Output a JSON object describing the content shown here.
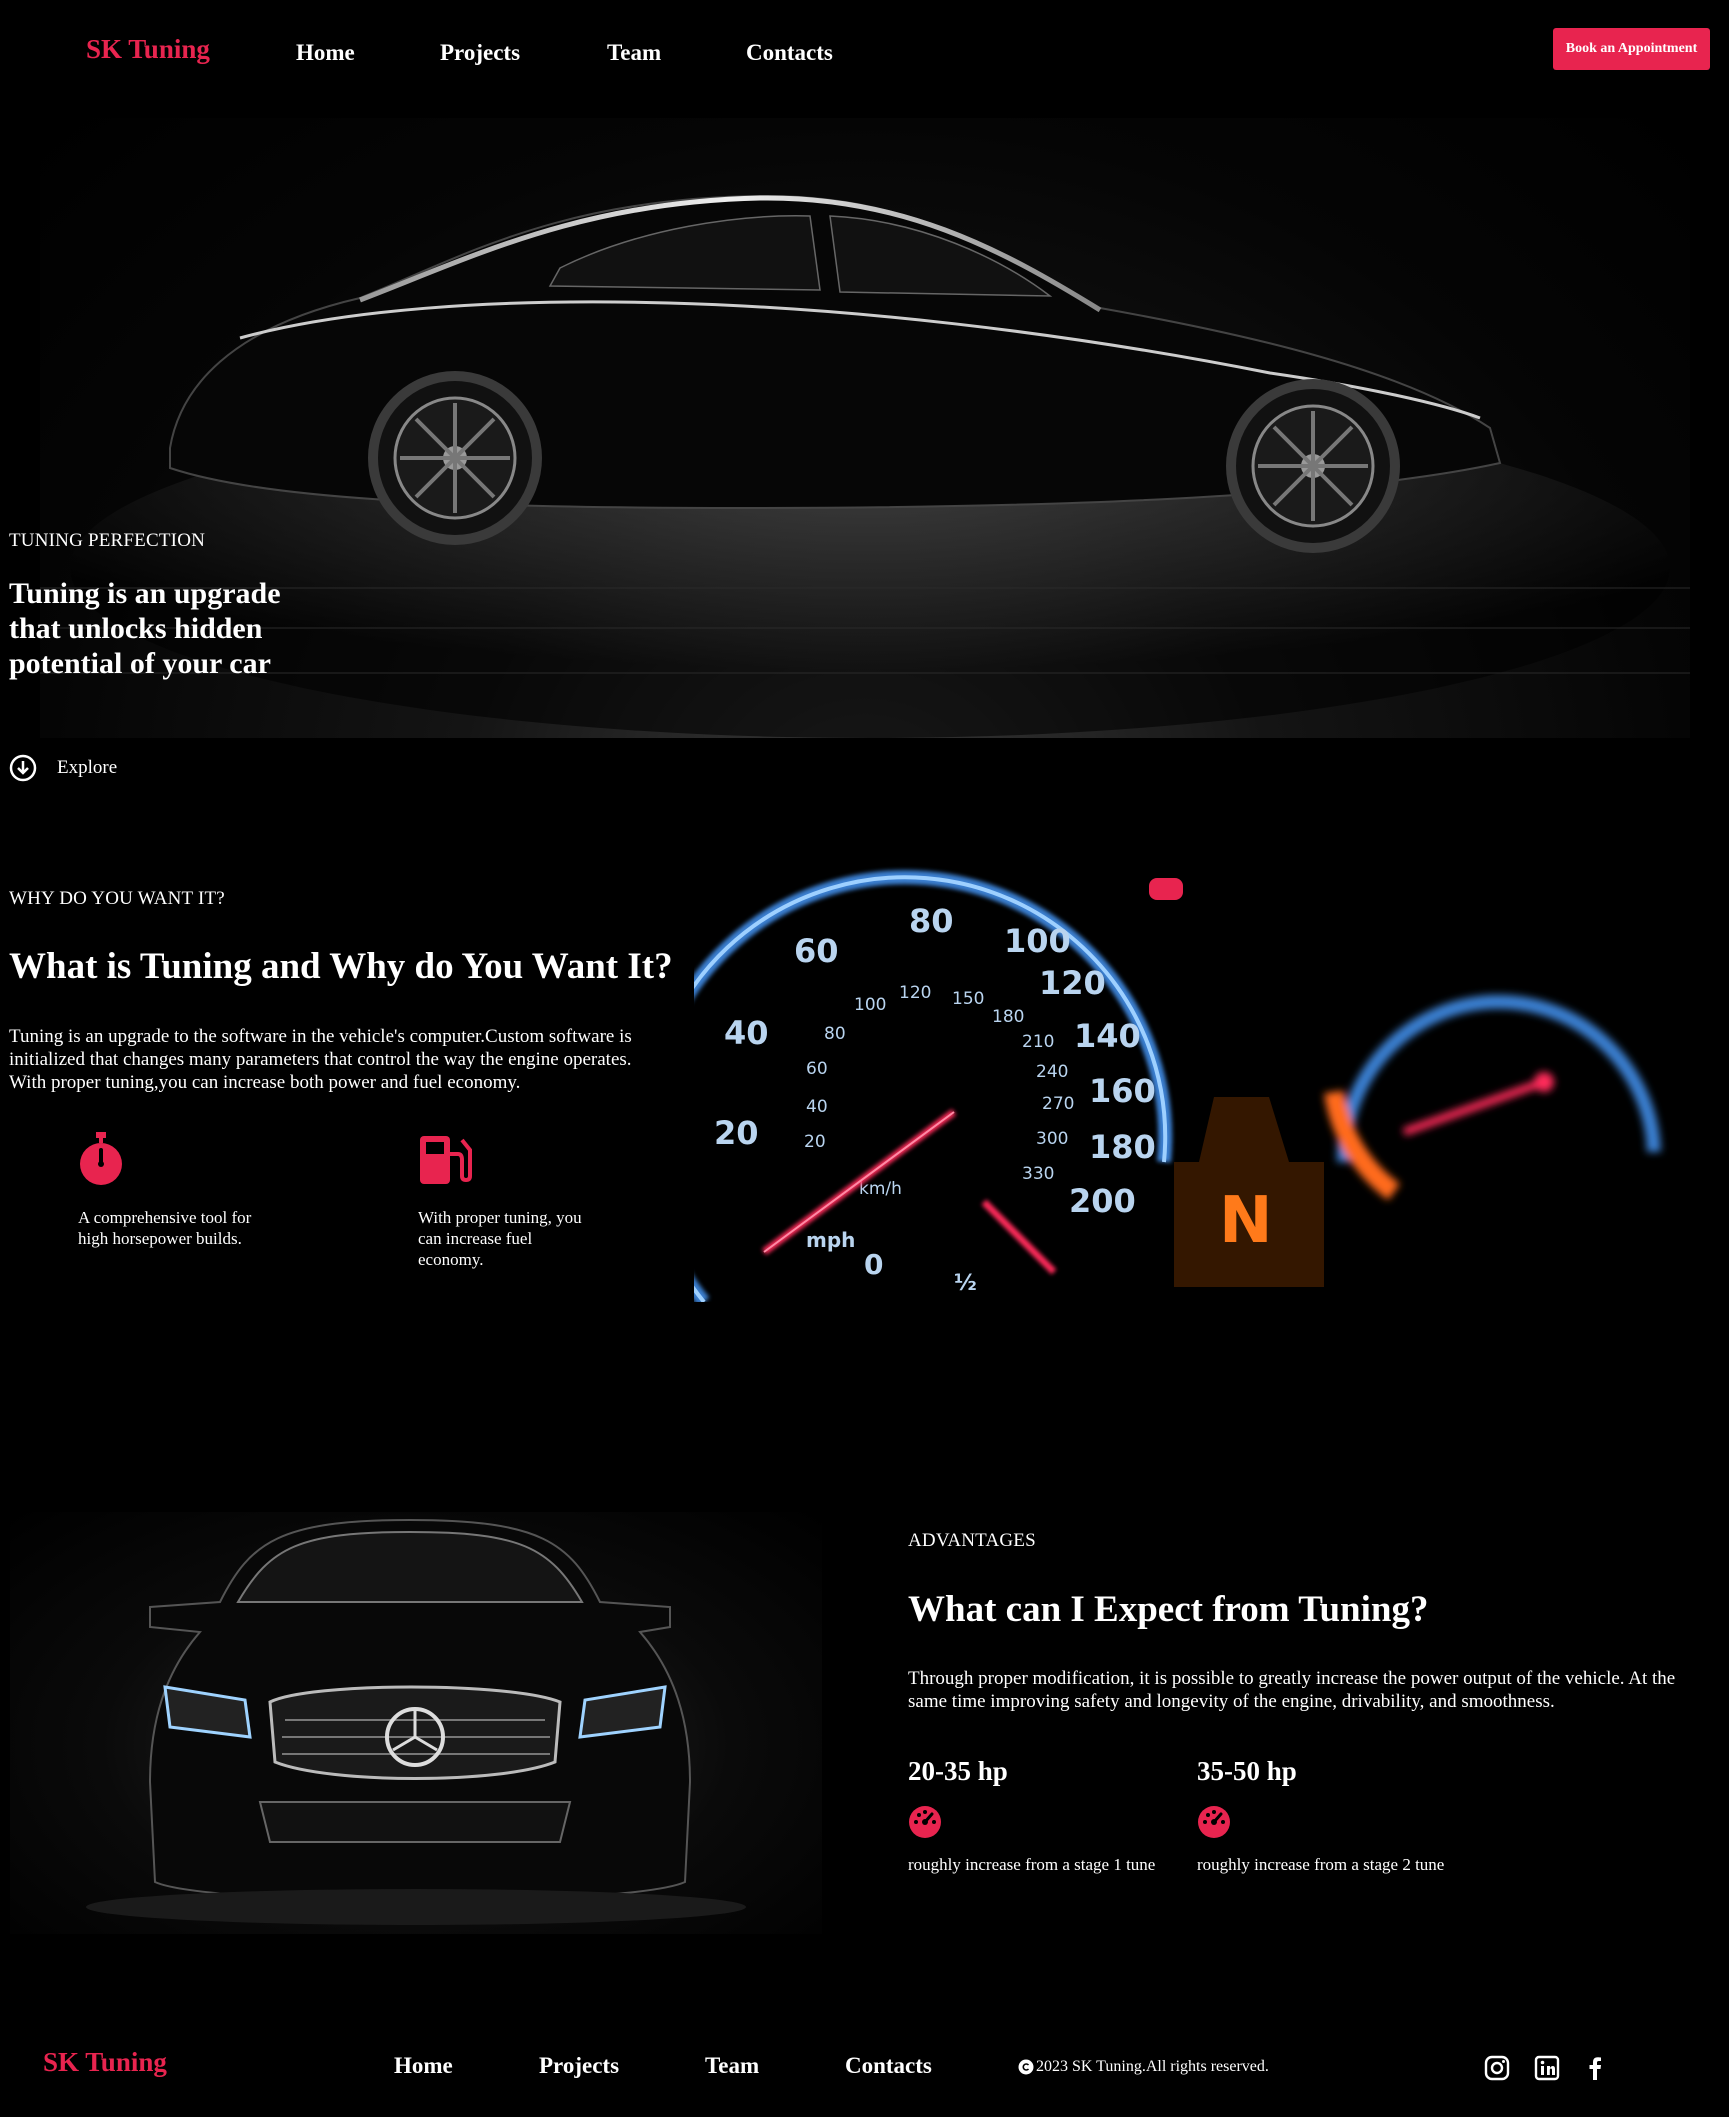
{
  "header": {
    "logo": "SK Tuning",
    "nav": [
      "Home",
      "Projects",
      "Team",
      "Contacts"
    ],
    "cta": "Book an Appointment"
  },
  "hero": {
    "eyebrow": "TUNING PERFECTION",
    "title": "Tuning is an upgrade that unlocks hidden potential of your car",
    "explore": "Explore"
  },
  "why": {
    "eyebrow": "WHY DO YOU WANT IT?",
    "title": "What is Tuning and Why do You Want It?",
    "paragraph": "Tuning is an upgrade to the software in the vehicle's computer.Custom software is initialized that changes many parameters that control the way the engine operates. With proper tuning,you can increase both power and fuel economy.",
    "features": [
      {
        "icon": "stopwatch-icon",
        "text": "A comprehensive tool for high horsepower builds."
      },
      {
        "icon": "fuel-pump-icon",
        "text": "With proper tuning, you can increase fuel economy."
      }
    ],
    "dashboard": {
      "speed_labels_outer": [
        "20",
        "40",
        "60",
        "80",
        "100",
        "120",
        "140",
        "160",
        "180",
        "200"
      ],
      "speed_labels_inner": [
        "20",
        "40",
        "60",
        "80",
        "100",
        "120",
        "150",
        "180",
        "210",
        "240",
        "270",
        "300",
        "330"
      ],
      "zero": "0",
      "units_inner": "km/h",
      "units_outer": "mph",
      "fuel_half": "½",
      "gear": "N"
    }
  },
  "advantages": {
    "eyebrow": "ADVANTAGES",
    "title": "What can I Expect from Tuning?",
    "paragraph": "Through proper modification, it is possible to greatly increase the power output of the vehicle. At the same time improving safety and longevity of the engine, drivability, and smoothness.",
    "stats": [
      {
        "value": "20-35 hp",
        "icon": "gauge-icon",
        "label": "roughly increase from a stage 1 tune"
      },
      {
        "value": "35-50 hp",
        "icon": "gauge-icon",
        "label": "roughly increase from a stage 2 tune"
      }
    ]
  },
  "footer": {
    "logo": "SK Tuning",
    "nav": [
      "Home",
      "Projects",
      "Team",
      "Contacts"
    ],
    "copyright": "2023 SK Tuning.All rights reserved.",
    "social": [
      "instagram-icon",
      "linkedin-icon",
      "facebook-icon"
    ]
  },
  "colors": {
    "accent": "#e8244f",
    "background": "#000000",
    "text": "#ffffff"
  }
}
